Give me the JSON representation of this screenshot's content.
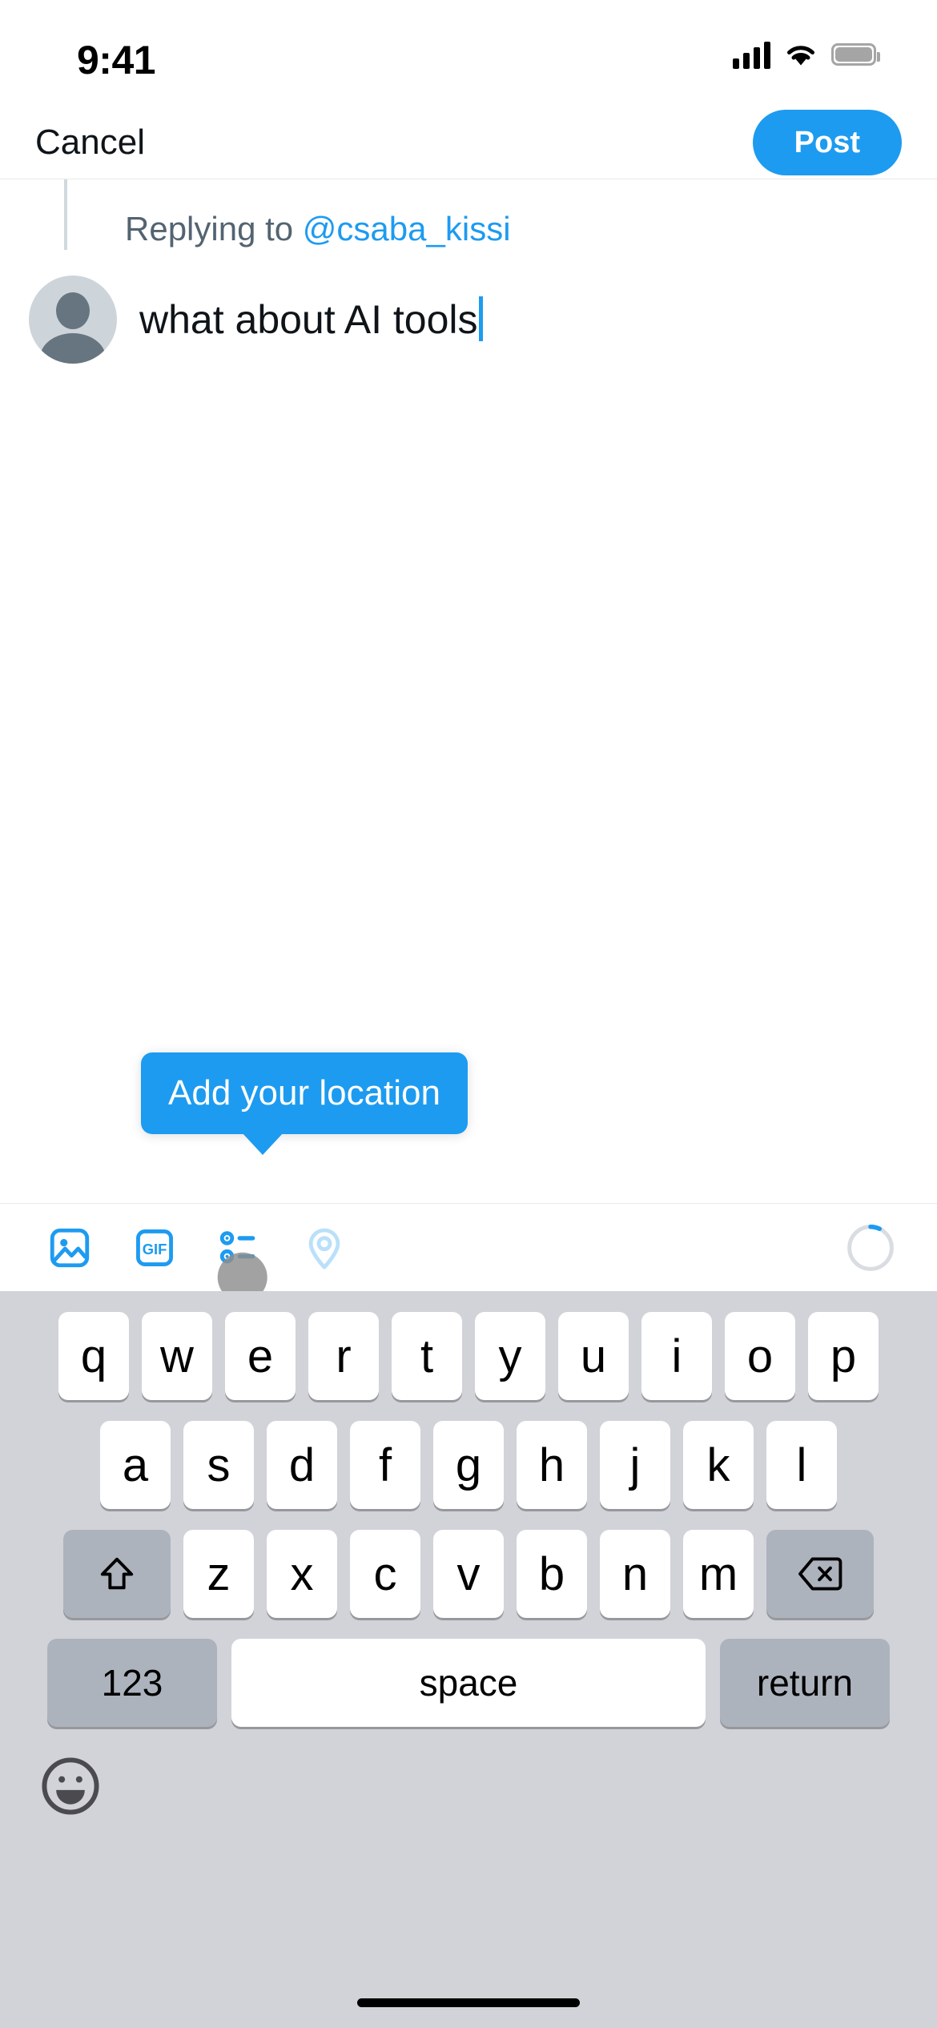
{
  "status_bar": {
    "time": "9:41",
    "cellular_icon": "signal-bars-icon",
    "wifi_icon": "wifi-icon",
    "battery_icon": "battery-full-icon"
  },
  "nav_bar": {
    "cancel_label": "Cancel",
    "post_label": "Post"
  },
  "compose": {
    "replying_prefix": "Replying to ",
    "replying_handle": "@csaba_kissi",
    "avatar_name": "default-avatar",
    "text_value": "what about AI tools",
    "caret_visible": true
  },
  "tooltip": {
    "text": "Add your location",
    "background_color": "#1d9bf0",
    "points_to": "location-button"
  },
  "toolbar": {
    "items": [
      {
        "name": "media-button",
        "icon": "image-icon",
        "label": "",
        "state": "enabled"
      },
      {
        "name": "gif-button",
        "icon": "gif-icon",
        "label": "GIF",
        "state": "enabled"
      },
      {
        "name": "poll-button",
        "icon": "poll-icon",
        "label": "",
        "state": "pressed"
      },
      {
        "name": "location-button",
        "icon": "location-pin-icon",
        "label": "",
        "state": "faded"
      }
    ],
    "char_counter": {
      "name": "character-count-ring",
      "progress_percent": 7,
      "track_color": "#d9dde1",
      "progress_color": "#1d9bf0"
    }
  },
  "keyboard": {
    "row1": [
      "q",
      "w",
      "e",
      "r",
      "t",
      "y",
      "u",
      "i",
      "o",
      "p"
    ],
    "row2": [
      "a",
      "s",
      "d",
      "f",
      "g",
      "h",
      "j",
      "k",
      "l"
    ],
    "row3": [
      "z",
      "x",
      "c",
      "v",
      "b",
      "n",
      "m"
    ],
    "shift_icon": "shift-arrow-icon",
    "delete_icon": "backspace-icon",
    "numbers_label": "123",
    "space_label": "space",
    "return_label": "return",
    "emoji_icon": "emoji-smiley-icon"
  },
  "colors": {
    "accent": "#1d9bf0",
    "text_primary": "#0f1419",
    "text_secondary": "#536471",
    "keyboard_bg": "#d1d3d9",
    "key_bg": "#ffffff",
    "key_modifier_bg": "#adb3bd"
  }
}
